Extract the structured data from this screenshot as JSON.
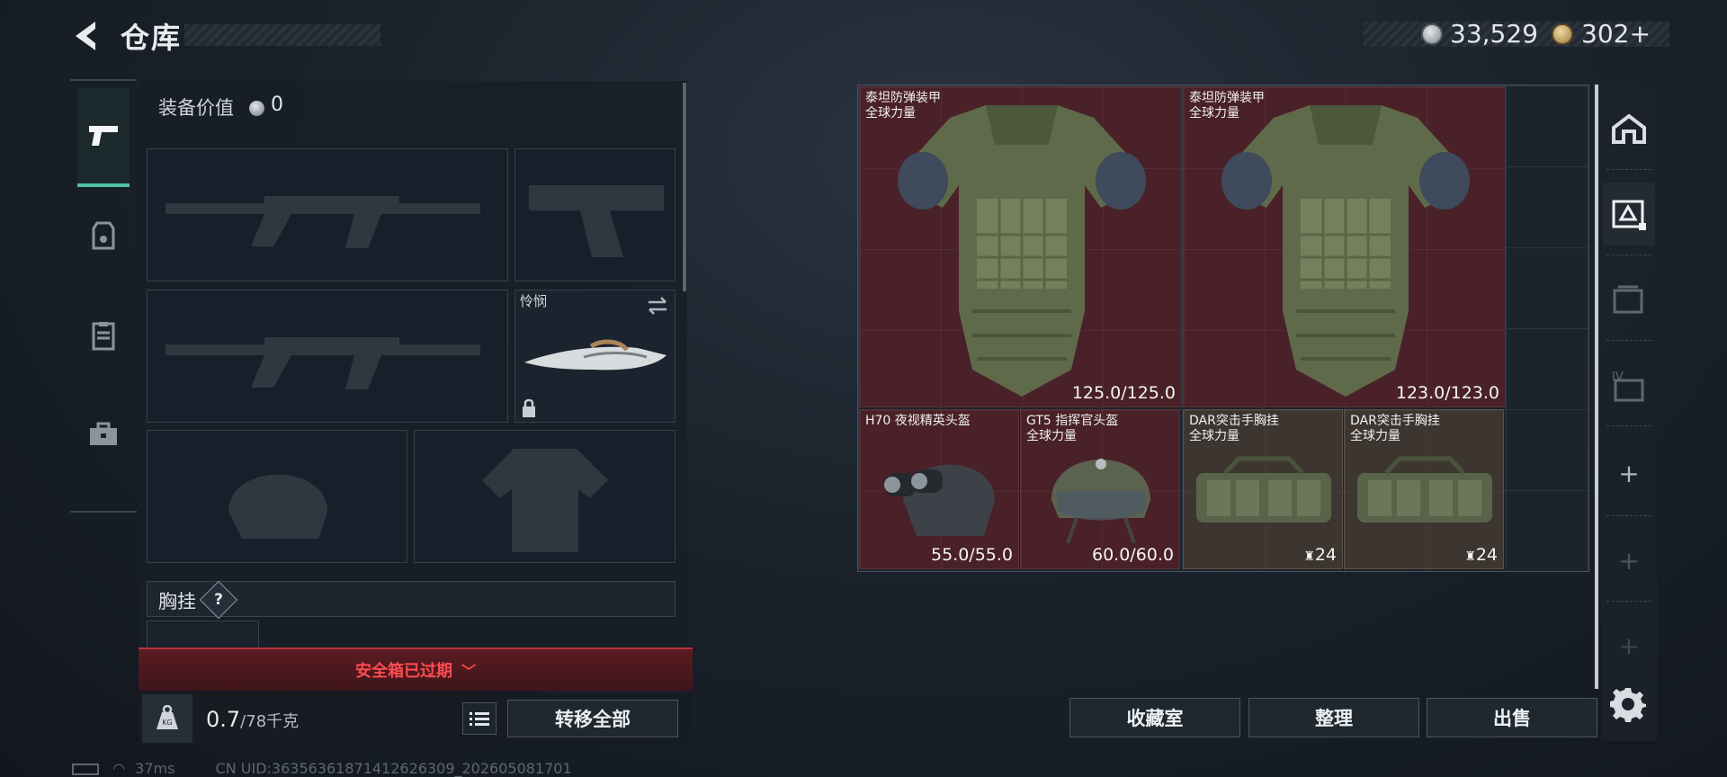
{
  "header": {
    "title": "仓库"
  },
  "currency": {
    "silver": "33,529",
    "gold": "302+"
  },
  "loadout": {
    "value_label": "装备价值",
    "value": "0",
    "melee_name": "怜悯",
    "chest_label": "胸挂",
    "chest_help": "?",
    "safe_box_status": "安全箱已过期",
    "weight_value": "0.7",
    "weight_unit": "/78千克",
    "transfer_all": "转移全部"
  },
  "status_bar": {
    "ping": "37ms",
    "uid": "CN UID:3635636187141262630​9_202605081701"
  },
  "storage": {
    "items": [
      {
        "name": "泰坦防弹装甲",
        "sub": "全球力量",
        "durability": "125.0/125.0"
      },
      {
        "name": "泰坦防弹装甲",
        "sub": "全球力量",
        "durability": "123.0/123.0"
      },
      {
        "name": "H70 夜视精英头盔",
        "sub": "",
        "durability": "55.0/55.0"
      },
      {
        "name": "GT5 指挥官头盔",
        "sub": "全球力量",
        "durability": "60.0/60.0"
      },
      {
        "name": "DAR突击手胸挂",
        "sub": "全球力量",
        "capacity": "24"
      },
      {
        "name": "DAR突击手胸挂",
        "sub": "全球力量",
        "capacity": "24"
      }
    ]
  },
  "actions": {
    "collection": "收藏室",
    "organize": "整理",
    "sell": "出售"
  },
  "side": {
    "plus": "+"
  },
  "icons": {
    "back": "back-arrow-icon",
    "silver": "silver-coin-icon",
    "gold": "gold-coin-icon",
    "weapons": "pistol-icon",
    "helmet": "armor-icon",
    "vest": "chest-rig-icon",
    "case": "toolbox-icon",
    "weight": "weight-icon",
    "list": "list-icon",
    "settings": "gear-icon"
  },
  "colors": {
    "accent": "#4fc0a0",
    "warning": "#ff4c52",
    "item_red": "#4a2128",
    "item_brown": "#3d3630"
  }
}
